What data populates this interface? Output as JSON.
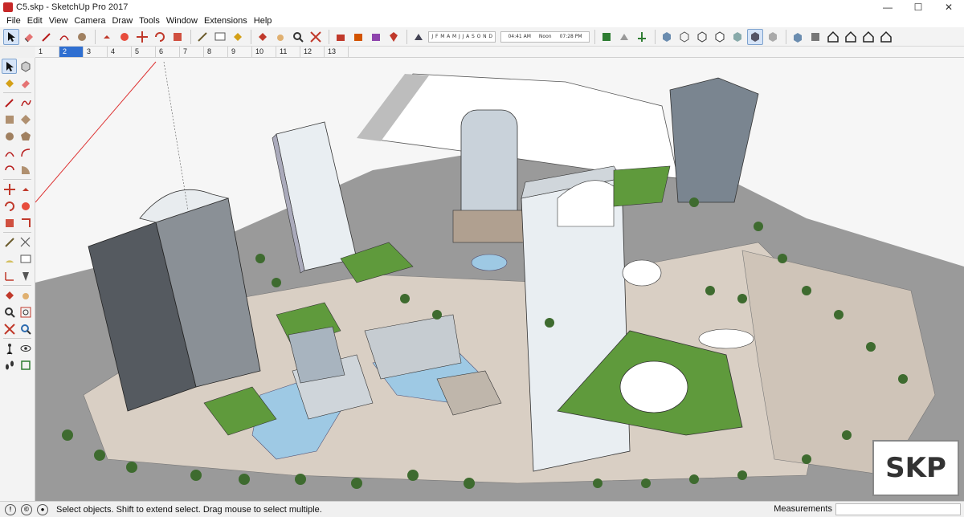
{
  "window": {
    "title": "C5.skp - SketchUp Pro 2017",
    "minimize": "—",
    "maximize": "☐",
    "close": "✕"
  },
  "menu": [
    "File",
    "Edit",
    "View",
    "Camera",
    "Draw",
    "Tools",
    "Window",
    "Extensions",
    "Help"
  ],
  "shadow": {
    "months": [
      "J",
      "F",
      "M",
      "A",
      "M",
      "J",
      "J",
      "A",
      "S",
      "O",
      "N",
      "D"
    ],
    "time_start": "04:41 AM",
    "time_mid": "Noon",
    "time_end": "07:28 PM"
  },
  "scenes": {
    "tabs": [
      "1",
      "2",
      "3",
      "4",
      "5",
      "6",
      "7",
      "8",
      "9",
      "10",
      "11",
      "12",
      "13"
    ],
    "active_index": 1
  },
  "status": {
    "message": "Select objects. Shift to extend select. Drag mouse to select multiple.",
    "measurements_label": "Measurements",
    "measurements_value": ""
  },
  "watermark": "SKP",
  "colors": {
    "accent": "#2f6fd1",
    "roof_green": "#5f9a3c",
    "ground": "#d9cfc4",
    "road": "#9a9a9a",
    "water": "#9ec9e4",
    "building_light": "#e9eef2",
    "building_dark": "#555a60"
  }
}
